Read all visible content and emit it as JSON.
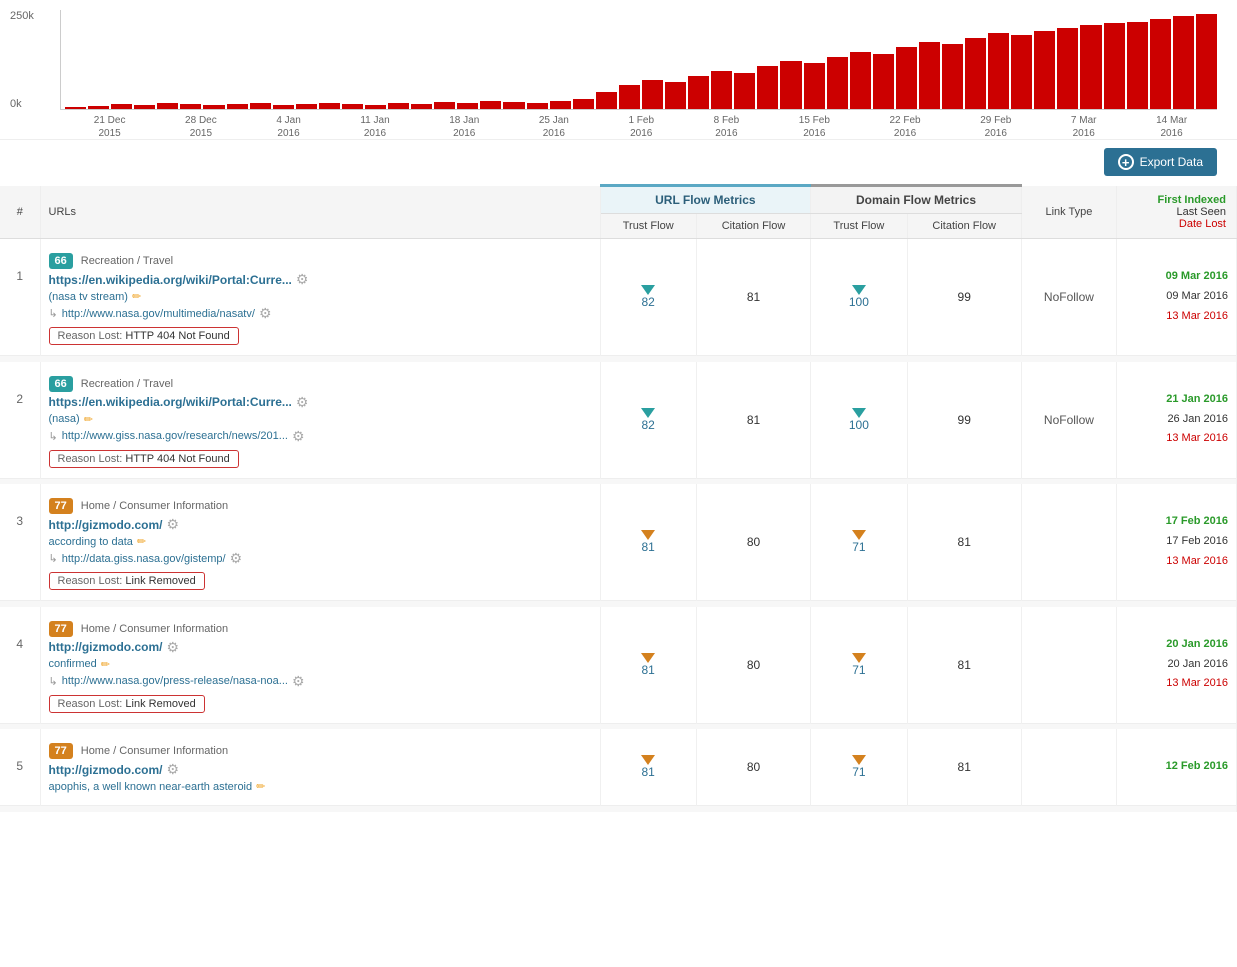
{
  "chart": {
    "y_labels": [
      "250k",
      "0k"
    ],
    "x_labels": [
      {
        "line1": "21 Dec",
        "line2": "2015"
      },
      {
        "line1": "28 Dec",
        "line2": "2015"
      },
      {
        "line1": "4 Jan",
        "line2": "2016"
      },
      {
        "line1": "11 Jan",
        "line2": "2016"
      },
      {
        "line1": "18 Jan",
        "line2": "2016"
      },
      {
        "line1": "25 Jan",
        "line2": "2016"
      },
      {
        "line1": "1 Feb",
        "line2": "2016"
      },
      {
        "line1": "8 Feb",
        "line2": "2016"
      },
      {
        "line1": "15 Feb",
        "line2": "2016"
      },
      {
        "line1": "22 Feb",
        "line2": "2016"
      },
      {
        "line1": "29 Feb",
        "line2": "2016"
      },
      {
        "line1": "7 Mar",
        "line2": "2016"
      },
      {
        "line1": "14 Mar",
        "line2": "2016"
      }
    ],
    "bars": [
      2,
      3,
      5,
      4,
      6,
      5,
      4,
      5,
      6,
      4,
      5,
      6,
      5,
      4,
      6,
      5,
      7,
      6,
      8,
      7,
      6,
      8,
      10,
      18,
      25,
      30,
      28,
      35,
      40,
      38,
      45,
      50,
      48,
      55,
      60,
      58,
      65,
      70,
      68,
      75,
      80,
      78,
      82,
      85,
      88,
      90,
      92,
      95,
      98,
      100
    ]
  },
  "export_btn": "Export Data",
  "table": {
    "col_hash": "#",
    "col_urls": "URLs",
    "group_url_flow": "URL Flow Metrics",
    "group_domain_flow": "Domain Flow Metrics",
    "sub_trust_flow": "Trust Flow",
    "sub_citation_flow": "Citation Flow",
    "sub_trust_flow_d": "Trust Flow",
    "sub_citation_flow_d": "Citation Flow",
    "col_link_type": "Link Type",
    "col_first_indexed": "First Indexed",
    "col_last_seen": "Last Seen",
    "col_date_lost": "Date Lost",
    "rows": [
      {
        "num": "1",
        "badge_val": "66",
        "badge_type": "teal",
        "category": "Recreation / Travel",
        "main_url": "https://en.wikipedia.org/wiki/Portal:Curre...",
        "anchor_text": "(nasa tv stream)",
        "target_url": "http://www.nasa.gov/multimedia/nasatv/",
        "reason_label": "Reason Lost:",
        "reason_value": "HTTP 404 Not Found",
        "trust_flow": "82",
        "citation_flow": "81",
        "domain_trust_flow": "100",
        "domain_citation_flow": "99",
        "link_type": "NoFollow",
        "first_indexed": "09 Mar 2016",
        "last_seen": "09 Mar 2016",
        "date_lost": "13 Mar 2016",
        "triangle_type": "teal"
      },
      {
        "num": "2",
        "badge_val": "66",
        "badge_type": "teal",
        "category": "Recreation / Travel",
        "main_url": "https://en.wikipedia.org/wiki/Portal:Curre...",
        "anchor_text": "(nasa)",
        "target_url": "http://www.giss.nasa.gov/research/news/201...",
        "reason_label": "Reason Lost:",
        "reason_value": "HTTP 404 Not Found",
        "trust_flow": "82",
        "citation_flow": "81",
        "domain_trust_flow": "100",
        "domain_citation_flow": "99",
        "link_type": "NoFollow",
        "first_indexed": "21 Jan 2016",
        "last_seen": "26 Jan 2016",
        "date_lost": "13 Mar 2016",
        "triangle_type": "teal"
      },
      {
        "num": "3",
        "badge_val": "77",
        "badge_type": "orange",
        "category": "Home / Consumer Information",
        "main_url": "http://gizmodo.com/",
        "anchor_text": "according to data",
        "target_url": "http://data.giss.nasa.gov/gistemp/",
        "reason_label": "Reason Lost:",
        "reason_value": "Link Removed",
        "trust_flow": "81",
        "citation_flow": "80",
        "domain_trust_flow": "71",
        "domain_citation_flow": "81",
        "link_type": "",
        "first_indexed": "17 Feb 2016",
        "last_seen": "17 Feb 2016",
        "date_lost": "13 Mar 2016",
        "triangle_type": "orange"
      },
      {
        "num": "4",
        "badge_val": "77",
        "badge_type": "orange",
        "category": "Home / Consumer Information",
        "main_url": "http://gizmodo.com/",
        "anchor_text": "confirmed",
        "target_url": "http://www.nasa.gov/press-release/nasa-noa...",
        "reason_label": "Reason Lost:",
        "reason_value": "Link Removed",
        "trust_flow": "81",
        "citation_flow": "80",
        "domain_trust_flow": "71",
        "domain_citation_flow": "81",
        "link_type": "",
        "first_indexed": "20 Jan 2016",
        "last_seen": "20 Jan 2016",
        "date_lost": "13 Mar 2016",
        "triangle_type": "orange"
      },
      {
        "num": "5",
        "badge_val": "77",
        "badge_type": "orange",
        "category": "Home / Consumer Information",
        "main_url": "http://gizmodo.com/",
        "anchor_text": "apophis, a well known near-earth asteroid",
        "target_url": "",
        "reason_label": "",
        "reason_value": "",
        "trust_flow": "81",
        "citation_flow": "80",
        "domain_trust_flow": "71",
        "domain_citation_flow": "81",
        "link_type": "",
        "first_indexed": "12 Feb 2016",
        "last_seen": "",
        "date_lost": "",
        "triangle_type": "orange"
      }
    ]
  }
}
